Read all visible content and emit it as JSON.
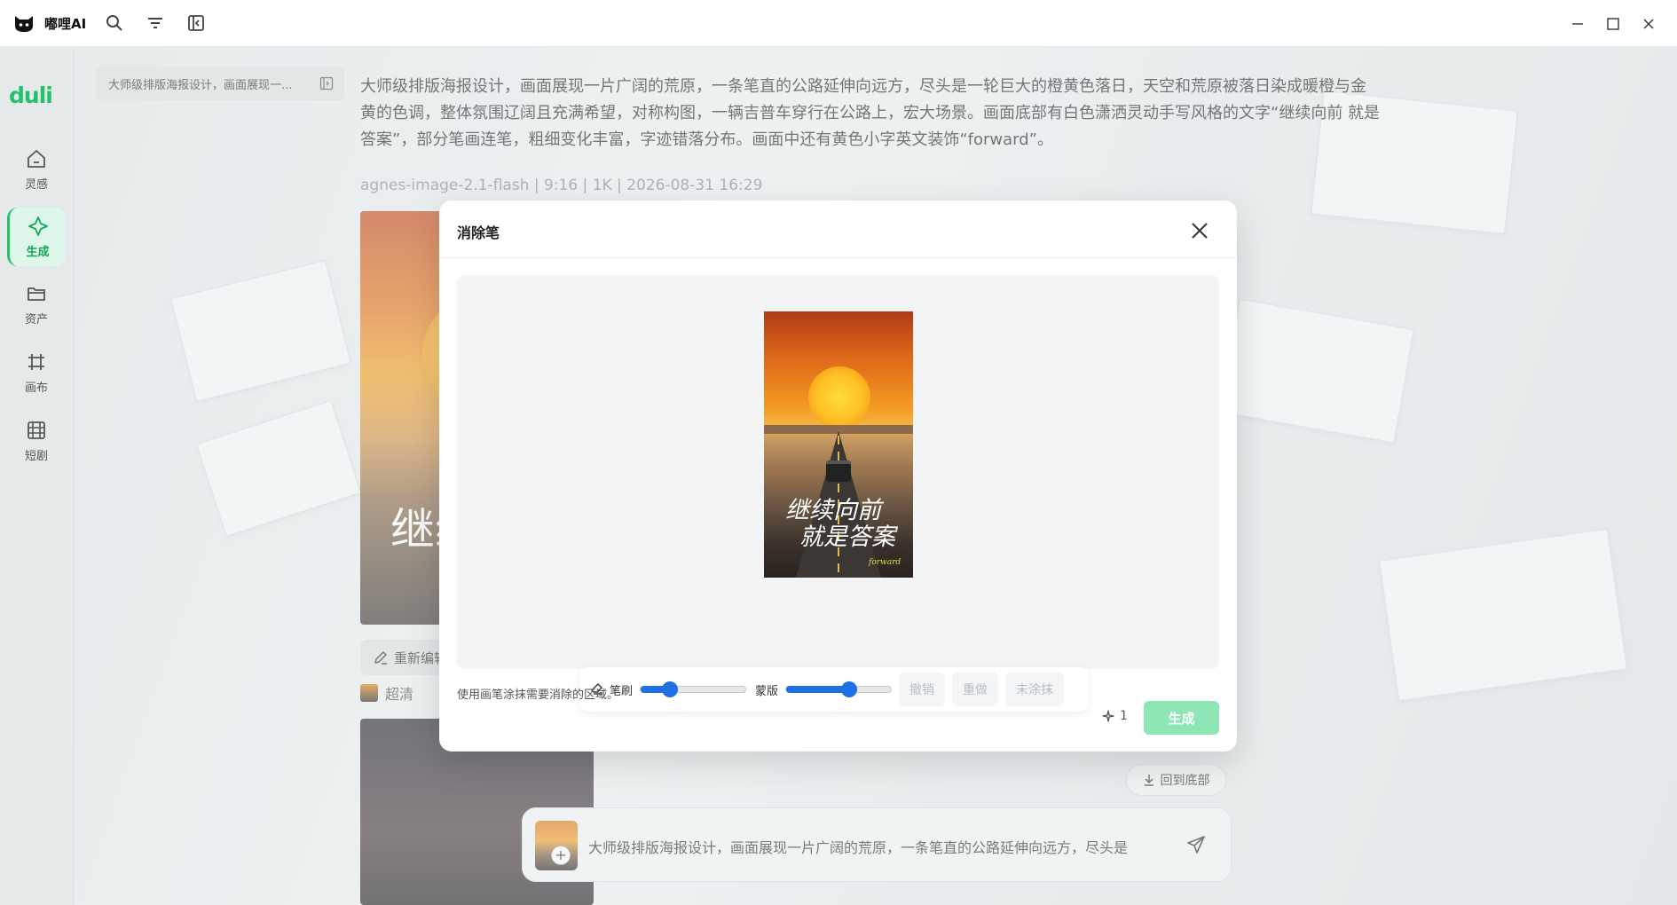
{
  "app": {
    "title": "嘟哩AI"
  },
  "sidebar": {
    "brand": "duli",
    "items": [
      {
        "label": "灵感",
        "icon": "home-icon"
      },
      {
        "label": "生成",
        "icon": "diamond-sparkle-icon",
        "active": true
      },
      {
        "label": "资产",
        "icon": "folder-icon"
      },
      {
        "label": "画布",
        "icon": "frame-icon"
      },
      {
        "label": "短剧",
        "icon": "film-icon"
      }
    ]
  },
  "thread": {
    "title": "大师级排版海报设计，画面展现一..."
  },
  "message": {
    "prompt": "大师级排版海报设计，画面展现一片广阔的荒原，一条笔直的公路延伸向远方，尽头是一轮巨大的橙黄色落日，天空和荒原被落日染成暖橙与金黄的色调，整体氛围辽阔且充满希望，对称构图，一辆吉普车穿行在公路上，宏大场景。画面底部有白色潇洒灵动手写风格的文字“继续向前 就是答案”，部分笔画连笔，粗细变化丰富，字迹错落分布。画面中还有黄色小字英文装饰“forward”。",
    "meta": "agnes-image-2.1-flash | 9:16 | 1K | 2026-08-31 16:29",
    "reedit_label": "重新编辑",
    "quality_label": "超清",
    "image_text": "继续 就"
  },
  "back_to_bottom": "回到底部",
  "chat": {
    "input_text": "大师级排版海报设计，画面展现一片广阔的荒原，一条笔直的公路延伸向远方，尽头是"
  },
  "modal": {
    "title": "消除笔",
    "image_calligraphy_line1": "继续向前",
    "image_calligraphy_line2": "就是答案",
    "image_english": "forward",
    "toolbar": {
      "brush_label": "笔刷",
      "brush_value": 0.28,
      "mask_label": "蒙版",
      "mask_value": 0.6,
      "undo_label": "撤销",
      "redo_label": "重做",
      "not_painted_label": "未涂抹"
    },
    "hint": "使用画笔涂抹需要消除的区域。",
    "credit_count": "1",
    "generate_label": "生成"
  },
  "colors": {
    "accent": "#22c26a",
    "generate_disabled": "#8de6b3",
    "slider": "#1f6fe5"
  }
}
